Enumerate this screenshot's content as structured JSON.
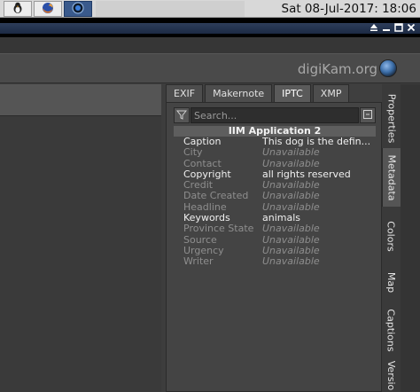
{
  "taskbar": {
    "clock": "Sat 08-Jul-2017: 18:06",
    "buttons": [
      {
        "icon": "penguin-icon"
      },
      {
        "icon": "firefox-icon"
      },
      {
        "icon": "digikam-icon"
      }
    ]
  },
  "window": {
    "controls": [
      "restore",
      "minimize",
      "maximize",
      "close"
    ]
  },
  "header": {
    "brand": "digiKam.org"
  },
  "metadata_tabs": [
    {
      "label": "EXIF",
      "active": false
    },
    {
      "label": "Makernote",
      "active": false
    },
    {
      "label": "IPTC",
      "active": true
    },
    {
      "label": "XMP",
      "active": false
    }
  ],
  "search": {
    "placeholder": "Search..."
  },
  "iptc": {
    "group_title": "IIM Application 2",
    "rows": [
      {
        "key": "Caption",
        "value": "This dog is the defin...",
        "set": true
      },
      {
        "key": "City",
        "value": "Unavailable",
        "set": false
      },
      {
        "key": "Contact",
        "value": "Unavailable",
        "set": false
      },
      {
        "key": "Copyright",
        "value": "all rights reserved",
        "set": true
      },
      {
        "key": "Credit",
        "value": "Unavailable",
        "set": false
      },
      {
        "key": "Date Created",
        "value": "Unavailable",
        "set": false
      },
      {
        "key": "Headline",
        "value": "Unavailable",
        "set": false
      },
      {
        "key": "Keywords",
        "value": "animals",
        "set": true
      },
      {
        "key": "Province State",
        "value": "Unavailable",
        "set": false
      },
      {
        "key": "Source",
        "value": "Unavailable",
        "set": false
      },
      {
        "key": "Urgency",
        "value": "Unavailable",
        "set": false
      },
      {
        "key": "Writer",
        "value": "Unavailable",
        "set": false
      }
    ]
  },
  "sidebar_tabs": [
    {
      "label": "Properties",
      "active": false
    },
    {
      "label": "Metadata",
      "active": true
    },
    {
      "label": "Colors",
      "active": false
    },
    {
      "label": "Map",
      "active": false
    },
    {
      "label": "Captions",
      "active": false
    },
    {
      "label": "Versio",
      "active": false
    }
  ],
  "colors": {
    "taskbar": "#d8d8d8",
    "panel": "#3f3f3f",
    "active_task": "#3a5a8c"
  }
}
